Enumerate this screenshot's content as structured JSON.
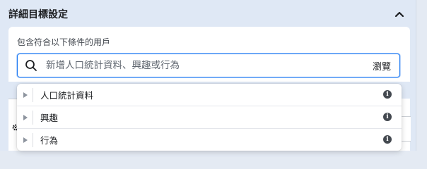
{
  "section": {
    "title": "詳細目標設定"
  },
  "card": {
    "label": "包含符合以下條件的用戶",
    "search": {
      "placeholder": "新增人口統計資料、興趣或行為",
      "browse_label": "瀏覽"
    }
  },
  "dropdown": {
    "items": [
      {
        "label": "人口統計資料",
        "icon": "info-icon"
      },
      {
        "label": "興趣",
        "icon": "info-icon"
      },
      {
        "label": "行為",
        "icon": "info-icon"
      }
    ]
  },
  "icons": {
    "collapse": "chevron-up-icon",
    "search": "search-icon",
    "expand": "caret-right-icon",
    "settings": "gear-icon"
  },
  "colors": {
    "accent": "#1877f2",
    "panel_bg": "#dfe8f5",
    "text": "#1c1e21"
  }
}
